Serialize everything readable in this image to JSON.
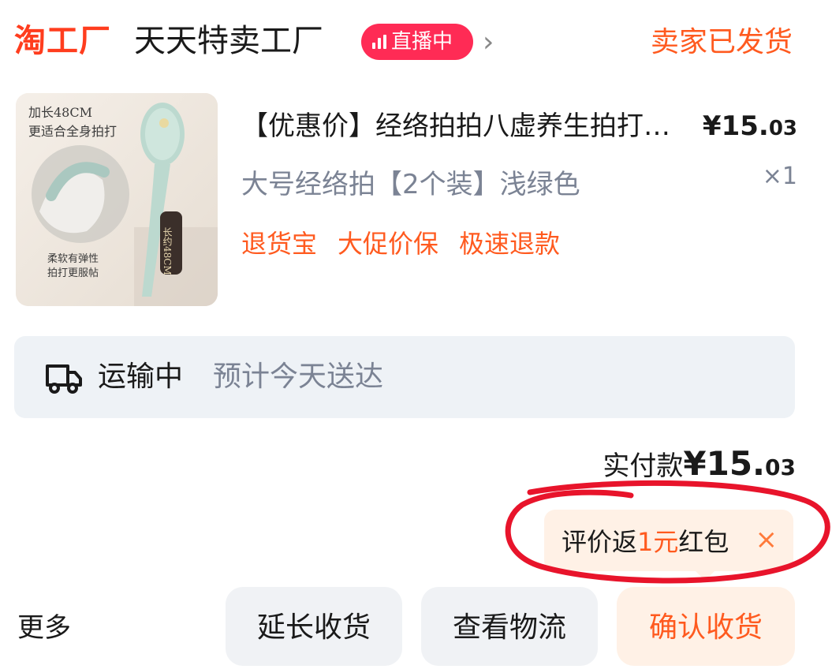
{
  "header": {
    "brand": "淘工厂",
    "shop_name": "天天特卖工厂",
    "live_badge": "直播中",
    "order_status": "卖家已发货"
  },
  "product": {
    "thumb_text_1": "加长48CM",
    "thumb_text_2": "更适合全身拍打",
    "thumb_text_3": "柔软有弹性",
    "thumb_text_4": "拍打更服帖",
    "thumb_vertical": "长约48CM",
    "title": "【优惠价】经络拍拍八虚养生拍打…",
    "price_int": "¥15.",
    "price_dec": "03",
    "variant": "大号经络拍【2个装】浅绿色",
    "quantity": "×1",
    "tags": [
      "退货宝",
      "大促价保",
      "极速退款"
    ]
  },
  "logistics": {
    "status": "运输中",
    "eta": "预计今天送达"
  },
  "payment": {
    "label": "实付款",
    "amount_int": "¥15.",
    "amount_dec": "03"
  },
  "review_tip": {
    "prefix": "评价返",
    "highlight": "1元",
    "suffix": "红包",
    "close": "×"
  },
  "actions": {
    "more": "更多",
    "extend": "延长收货",
    "logistics": "查看物流",
    "confirm": "确认收货"
  },
  "colors": {
    "accent": "#ff5a1f",
    "brand": "#ff3d1e",
    "live": "#ff2b55",
    "annotation_circle": "#e8142b"
  }
}
